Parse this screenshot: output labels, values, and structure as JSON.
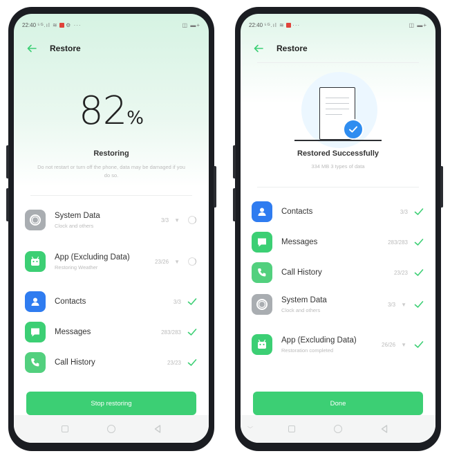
{
  "left_phone": {
    "status_bar": {
      "time": "22:40",
      "signal": "⁵ᴳ.ıl ≋",
      "menu": "⚙ ···",
      "battery": "◫ ▬+"
    },
    "header": {
      "title": "Restore"
    },
    "progress": {
      "percent_value": "82",
      "percent_sign": "%",
      "fraction": 0.82
    },
    "status_title": "Restoring",
    "status_note": "Do not restart or turn off the phone, data may be damaged if you do so.",
    "items": [
      {
        "name": "System Data",
        "sub": "Clock and others",
        "count": "3/3",
        "state": "in-progress"
      },
      {
        "name": "App (Excluding Data)",
        "sub": "Restoring Weather",
        "count": "23/26",
        "state": "in-progress"
      },
      {
        "name": "Contacts",
        "sub": "",
        "count": "3/3",
        "state": "done"
      },
      {
        "name": "Messages",
        "sub": "",
        "count": "283/283",
        "state": "done"
      },
      {
        "name": "Call History",
        "sub": "",
        "count": "23/23",
        "state": "done"
      }
    ],
    "button_label": "Stop restoring"
  },
  "right_phone": {
    "status_bar": {
      "time": "22:40",
      "signal": "⁵ᴳ.ıl ≋",
      "menu": "···",
      "battery": "◫ ▬+"
    },
    "header": {
      "title": "Restore"
    },
    "status_title": "Restored Successfully",
    "status_note": "334 MB  3 types of data",
    "items": [
      {
        "name": "Contacts",
        "sub": "",
        "count": "3/3",
        "state": "done"
      },
      {
        "name": "Messages",
        "sub": "",
        "count": "283/283",
        "state": "done"
      },
      {
        "name": "Call History",
        "sub": "",
        "count": "23/23",
        "state": "done"
      },
      {
        "name": "System Data",
        "sub": "Clock and others",
        "count": "3/3",
        "state": "done"
      },
      {
        "name": "App (Excluding Data)",
        "sub": "Restoration completed",
        "count": "26/26",
        "state": "done"
      }
    ],
    "button_label": "Done"
  },
  "colors": {
    "accent": "#3ccf74",
    "blue": "#2f7cf0",
    "gray_icon": "#a9adb1"
  },
  "icons": {
    "system": "gear-circle-icon",
    "app": "android-app-icon",
    "contacts": "person-icon",
    "messages": "chat-bubble-icon",
    "call": "phone-icon"
  }
}
